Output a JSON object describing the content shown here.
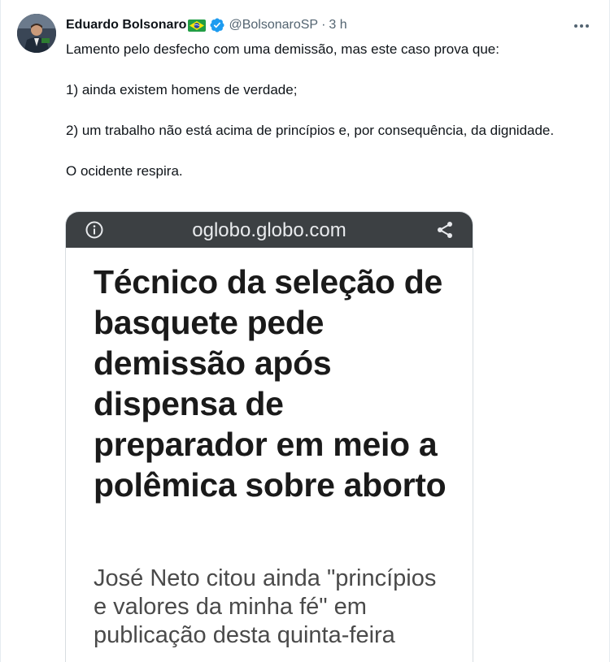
{
  "tweet": {
    "author_name": "Eduardo Bolsonaro",
    "handle": "@BolsonaroSP",
    "separator": "·",
    "time": "3 h",
    "paragraphs": [
      "Lamento pelo desfecho com uma demissão, mas este caso prova que:",
      "1) ainda existem homens de verdade;",
      "2) um trabalho não está acima de princípios e, por consequência, da dignidade.",
      "O ocidente respira."
    ]
  },
  "card": {
    "domain": "oglobo.globo.com",
    "headline": "Técnico da seleção de basquete pede demissão após dispensa de preparador em meio a polêmica sobre aborto",
    "subheadline": "José Neto citou ainda \"princípios e valores da minha fé\" em publicação desta quinta-feira"
  },
  "icons": {
    "flag": "brazil-flag-icon",
    "verified": "verified-badge-icon",
    "more": "more-options-icon",
    "info": "info-icon",
    "share": "share-icon"
  },
  "colors": {
    "verified_blue": "#1d9bf0",
    "card_bar": "#3c4043",
    "secondary_text": "#536471"
  }
}
